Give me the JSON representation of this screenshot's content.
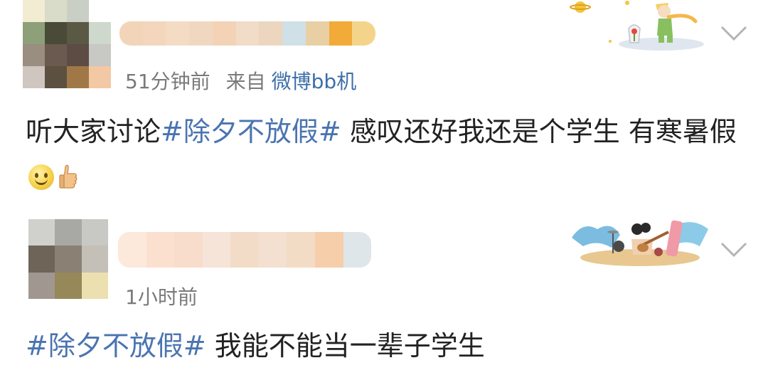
{
  "posts": [
    {
      "time": "51分钟前",
      "source_label": "来自",
      "source_app": "微博bb机",
      "text_before": "听大家讨论",
      "hashtag": "#除夕不放假#",
      "text_after": " 感叹还好我还是个学生 有寒暑假",
      "emojis": [
        "smile-emoji",
        "thumbs-up-emoji"
      ],
      "avatar_colors": [
        "#f2ecd2",
        "#d8dcc8",
        "#c9cfc4",
        "#ffffff",
        "#8da07a",
        "#4a4a38",
        "#5a5a44",
        "#cfd8cc",
        "#9a8e80",
        "#6a5a50",
        "#5c4c44",
        "#c8c8c4",
        "#cfc6c0",
        "#5c5040",
        "#a07848",
        "#f3c8a4"
      ],
      "name_colors": [
        "#f2d4b8",
        "#f3d6bc",
        "#f4dcc4",
        "#f0d8c0",
        "#f3d2b6",
        "#f1dcc8",
        "#ecd6c0",
        "#cfe0e6",
        "#e8d0a4",
        "#f2aa38",
        "#f4d48a"
      ]
    },
    {
      "time": "1小时前",
      "hashtag": "#除夕不放假#",
      "text_after": " 我能不能当一辈子学生",
      "avatar_colors": [
        "#d0d0cc",
        "#a8a8a4",
        "#c8c8c4",
        "#6e6458",
        "#8a8074",
        "#c4c0b8",
        "#a09890",
        "#968858",
        "#ece0b0"
      ],
      "name_colors": [
        "#fde8dc",
        "#fbe0d0",
        "#f8dccc",
        "#f6e4d8",
        "#f2dcc8",
        "#f4e0d0",
        "#f3dcc6",
        "#f6ceaa",
        "#dfe6ea"
      ]
    }
  ],
  "icons": {
    "more_menu": "chevron-down-icon",
    "badge_1": "little-prince-badge",
    "badge_2": "band-music-badge"
  },
  "colors": {
    "hashtag": "#4a74b0",
    "meta": "#7a7a7a",
    "source_app": "#3d6fa8",
    "text": "#222222"
  }
}
